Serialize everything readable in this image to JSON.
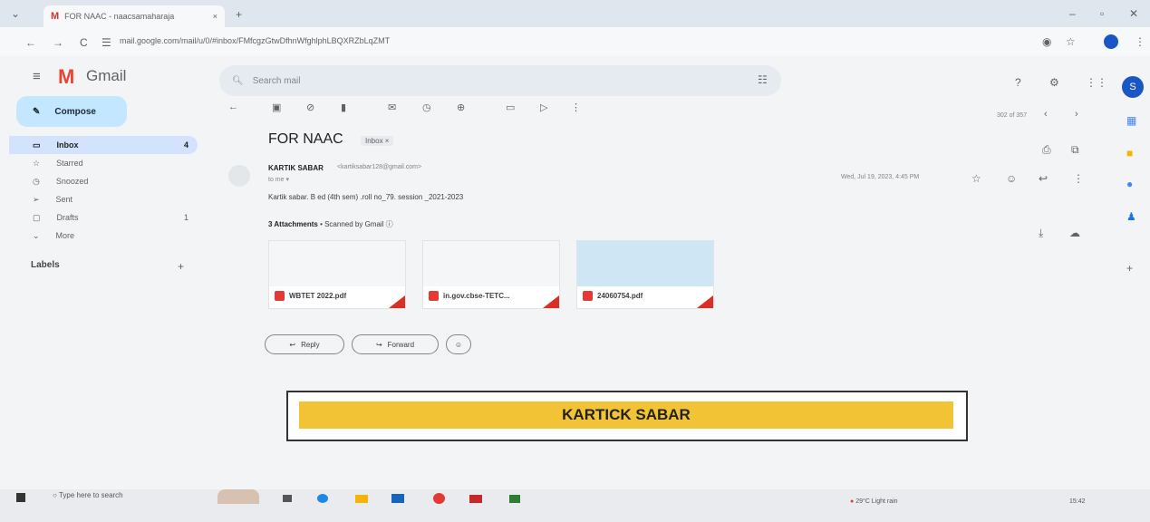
{
  "browser": {
    "tab_title": "FOR NAAC - naacsamaharaja",
    "tab_close": "×",
    "new_tab": "+",
    "url": "mail.google.com/mail/u/0/#inbox/FMfcgzGtwDfhnWfghlphLBQXRZbLqZMT",
    "back": "←",
    "forward": "→",
    "reload": "C"
  },
  "gmail": {
    "logo_text": "Gmail",
    "search_placeholder": "Search mail",
    "compose_label": "Compose",
    "sidebar": [
      {
        "label": "Inbox",
        "count": "4",
        "icon": "inbox-icon"
      },
      {
        "label": "Starred",
        "count": "",
        "icon": "star-icon"
      },
      {
        "label": "Snoozed",
        "count": "",
        "icon": "clock-icon"
      },
      {
        "label": "Sent",
        "count": "",
        "icon": "send-icon"
      },
      {
        "label": "Drafts",
        "count": "1",
        "icon": "draft-icon"
      },
      {
        "label": "More",
        "count": "",
        "icon": "chevron-down-icon"
      }
    ],
    "labels_heading": "Labels",
    "pager": "302 of 357",
    "email": {
      "subject": "FOR NAAC",
      "chip": "Inbox ×",
      "sender_name": "KARTIK SABAR",
      "sender_email": "<kartiksabar128@gmail.com>",
      "to": "to me ▾",
      "date": "Wed, Jul 19, 2023, 4:45 PM",
      "body": "Kartik sabar. B ed (4th sem) .roll no_79. session _2021-2023",
      "attachments_heading": "3 Attachments",
      "attachments_scanned": "• Scanned by Gmail ⓘ",
      "attachments": [
        {
          "name": "WBTET 2022.pdf"
        },
        {
          "name": "in.gov.cbse-TETC..."
        },
        {
          "name": "24060754.pdf"
        }
      ],
      "reply_label": "Reply",
      "forward_label": "Forward"
    }
  },
  "banner_text": "KARTICK SABAR",
  "taskbar": {
    "search_text": "Type here to search",
    "weather": "29°C Light rain",
    "time": "15:42"
  },
  "colors": {
    "accent": "#c2e7ff",
    "banner": "#f2c335",
    "gmail_red": "#ea4335"
  }
}
